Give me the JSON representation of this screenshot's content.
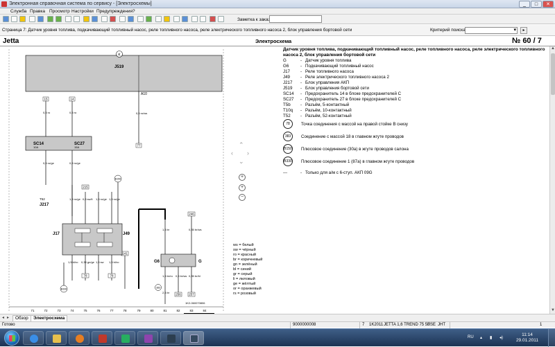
{
  "window": {
    "title": "Электронная справочная система по сервису - [Электросхемы]",
    "controls": [
      "_",
      "□",
      "✕"
    ]
  },
  "menu": [
    "Служба",
    "Правка",
    "Просмотр",
    "Настройки",
    "Предупреждения",
    "?"
  ],
  "toolbar": {
    "order_label": "Заметка к заказу:",
    "order_value": ""
  },
  "breadcrumb": {
    "text": "Страница 7: Датчик уровня топлива, подкачивающий топливный насос, реле топливного насоса, реле электрического топливного насоса 2, блок управления бортовой сети",
    "search_label": "Критерий поиска:",
    "search_value": "",
    "search_btn": "▸"
  },
  "doc": {
    "model": "Jetta",
    "title": "Электросхема",
    "page": "№  60 / 7"
  },
  "legend": {
    "heading": "Датчик уровня топлива, подкачивающий топливный насос, реле топливного насоса, реле электрического топливного насоса 2, блок управления бортовой сети",
    "items": [
      {
        "code": "G",
        "desc": "Датчик уровня топлива"
      },
      {
        "code": "G6",
        "desc": "Подкачивающий топливный насос"
      },
      {
        "code": "J17",
        "desc": "Реле топливного насоса"
      },
      {
        "code": "J49",
        "desc": "Реле электрического топливного насоса 2"
      },
      {
        "code": "J217",
        "desc": "Блок управления АКП"
      },
      {
        "code": "J519",
        "desc": "Блок управления бортовой сети"
      },
      {
        "code": "SC14",
        "desc": "Предохранитель 14 в блоке предохранителей C"
      },
      {
        "code": "SC27",
        "desc": "Предохранитель 27 в блоке предохранителей C"
      },
      {
        "code": "T5b",
        "desc": "Разъём, 5-контактный"
      },
      {
        "code": "T10q",
        "desc": "Разъём, 10-контактный"
      },
      {
        "code": "T52",
        "desc": "Разъём, 52-контактный"
      }
    ],
    "grounds": [
      {
        "code": "78",
        "desc": "Точка соединения с массой на правой стойке B снизу"
      },
      {
        "code": "383",
        "desc": "Соединение с массой 18 в главном жгуте проводов"
      },
      {
        "code": "B150",
        "desc": "Плюсовое соединение (30a) в жгуте проводов салона"
      },
      {
        "code": "B330",
        "desc": "Плюсовое соединение 1 (87a) в главном жгуте проводов"
      }
    ],
    "note_code": "---",
    "note_desc": "Только для а/м с 6-ступ. АКП 09G"
  },
  "wire_colors": [
    "ws = белый",
    "sw = чёрный",
    "ro = красный",
    "br = коричневый",
    "gn = зелёный",
    "bl = синий",
    "gr = серый",
    "li = лиловый",
    "ge = жёлтый",
    "or = оранжевый",
    "rs = розовый"
  ],
  "schematic": {
    "j519_label": "J519",
    "k_badge": "K",
    "a10": "A10",
    "t52": "T52",
    "sc14": "SC14",
    "sc14_amp": "10A",
    "sc27": "SC27",
    "sc27_amp": "15A",
    "j217": "J217",
    "j17": "J17",
    "j49": "J49",
    "g6g": "G6",
    "g": "G",
    "box_ids": [
      "15",
      "14",
      "77",
      "215",
      "246",
      "141",
      "383",
      "256",
      "257",
      "78"
    ],
    "circles": [
      "B150",
      "B330",
      "383"
    ],
    "wire_labels": [
      "0,5 ro",
      "0,5 ro",
      "0,5 ro/ws",
      "0,5 ro/ge",
      "0,5 ro/ge",
      "1,5 ro/ge",
      "0,5 sw/li",
      "1,5 ro/ge",
      "1,5 ro/ge",
      "1,5 bl/ro",
      "0,35 gn/ge",
      "1,5 sw",
      "1,5 bl/ro",
      "1,5 br",
      "0,35 br/ws",
      "1,5 br/ro",
      "0,5 br/ws",
      "0,35 br/bl",
      "2,5 br"
    ],
    "bottom_numbers": [
      "71",
      "72",
      "73",
      "74",
      "75",
      "76",
      "77",
      "78",
      "79",
      "80",
      "81",
      "82",
      "83",
      "84"
    ],
    "part_code": "1K2-060070806"
  },
  "tabs": {
    "items": [
      "Обзор",
      "Электросхема"
    ]
  },
  "status": {
    "ready": "Готово",
    "code1": "9000000008",
    "code2": "7",
    "vehicle": "1K2011",
    "model": "JETTA 1,6 TREND 75 5F",
    "engine": "BSE",
    "gear": "JHT",
    "page": "1"
  },
  "taskbar": {
    "lang": "RU",
    "time": "11:14",
    "date": "29.01.2011"
  }
}
